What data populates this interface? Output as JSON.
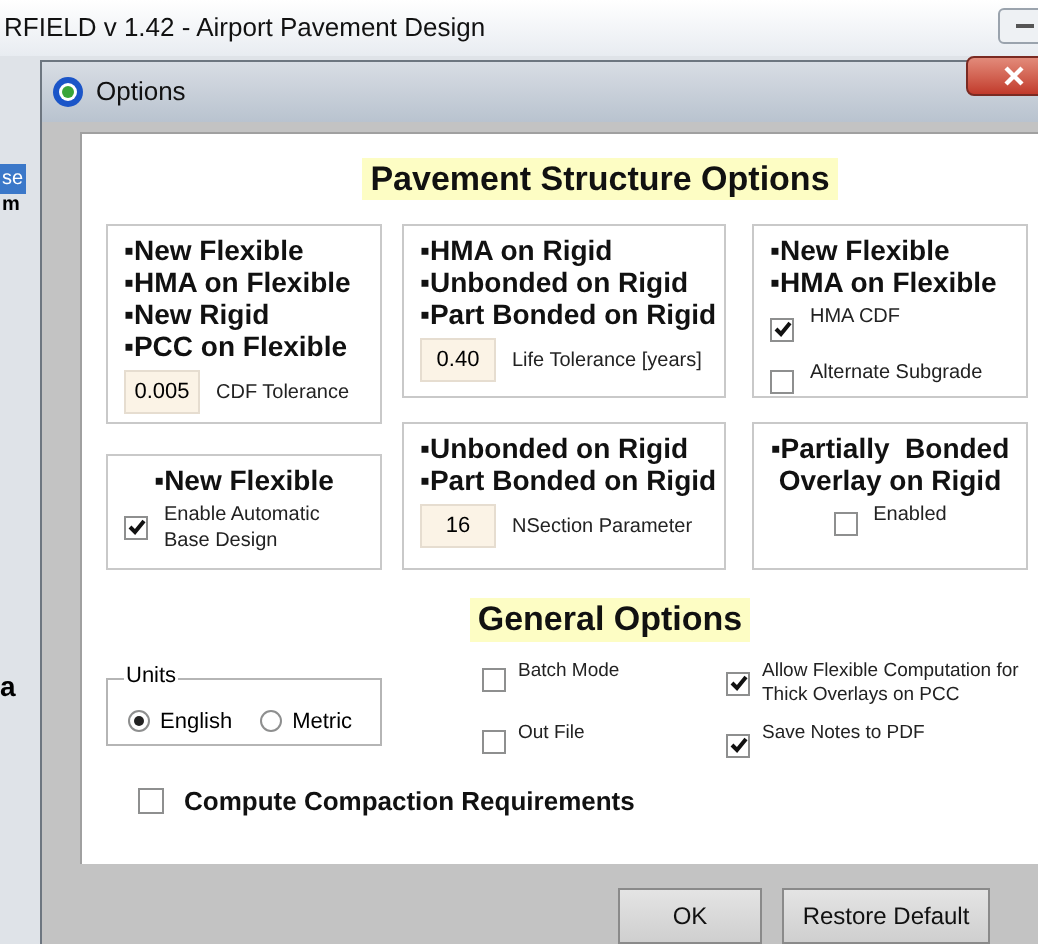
{
  "app_title": "RFIELD v 1.42 - Airport Pavement Design",
  "background_fragments": [
    "se",
    "m",
    "a"
  ],
  "dialog": {
    "title": "Options"
  },
  "pavement_section": {
    "heading": "Pavement Structure Options",
    "groups": [
      {
        "lines": [
          "▪New Flexible",
          "▪HMA on Flexible",
          "▪New Rigid",
          "▪PCC on Flexible"
        ],
        "controls": [
          {
            "kind": "field",
            "value": "0.005",
            "label": "CDF Tolerance"
          }
        ]
      },
      {
        "lines": [
          "▪HMA on Rigid",
          "▪Unbonded on Rigid",
          "▪Part Bonded on Rigid"
        ],
        "controls": [
          {
            "kind": "field",
            "value": "0.40",
            "label": "Life Tolerance [years]"
          }
        ]
      },
      {
        "lines": [
          "▪New Flexible",
          "▪HMA on Flexible"
        ],
        "controls": [
          {
            "kind": "checkbox",
            "label": "HMA CDF",
            "checked": true
          },
          {
            "kind": "checkbox",
            "label": "Alternate Subgrade",
            "checked": false
          }
        ]
      },
      {
        "lines": [
          "▪New Flexible"
        ],
        "controls": [
          {
            "kind": "checkbox",
            "label": "Enable Automatic Base Design",
            "checked": true
          }
        ]
      },
      {
        "lines": [
          "▪Unbonded on Rigid",
          "▪Part Bonded on Rigid"
        ],
        "controls": [
          {
            "kind": "field",
            "value": "16",
            "label": "NSection Parameter"
          }
        ]
      },
      {
        "lines": [
          "▪Partially  Bonded",
          "Overlay on Rigid"
        ],
        "controls": [
          {
            "kind": "checkbox",
            "label": "Enabled",
            "checked": false
          }
        ]
      }
    ]
  },
  "general_section": {
    "heading": "General Options",
    "units": {
      "label": "Units",
      "options": [
        {
          "label": "English",
          "selected": true
        },
        {
          "label": "Metric",
          "selected": false
        }
      ]
    },
    "checkboxes": [
      {
        "label": "Batch Mode",
        "checked": false
      },
      {
        "label": "Allow Flexible Computation for Thick Overlays on PCC",
        "checked": true
      },
      {
        "label": "Out File",
        "checked": false
      },
      {
        "label": "Save Notes to PDF",
        "checked": true
      }
    ],
    "compaction": {
      "label": "Compute Compaction Requirements",
      "checked": false
    }
  },
  "buttons": [
    {
      "label": "OK"
    },
    {
      "label": "Restore Default"
    }
  ]
}
